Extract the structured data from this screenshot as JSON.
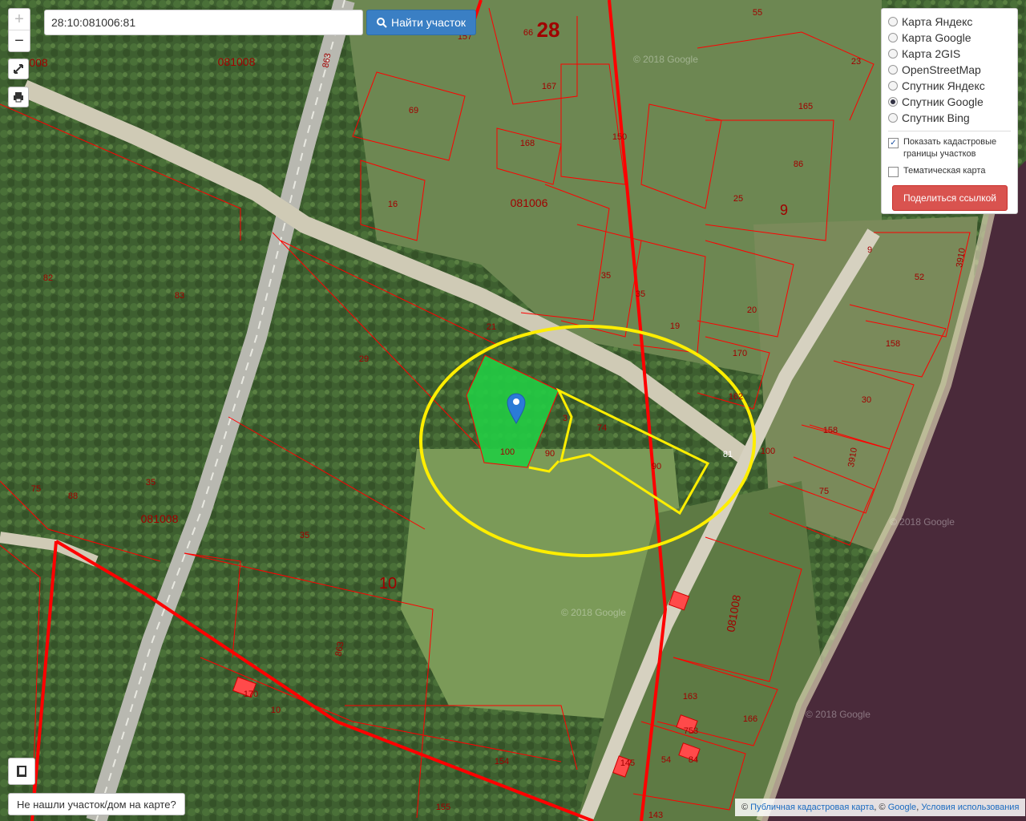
{
  "search": {
    "value": "28:10:081006:81",
    "button_label": "Найти участок"
  },
  "zoom": {
    "plus": "+",
    "minus": "−"
  },
  "layers": {
    "options": [
      "Карта Яндекс",
      "Карта Google",
      "Карта 2GIS",
      "OpenStreetMap",
      "Спутник Яндекс",
      "Спутник Google",
      "Спутник Bing"
    ],
    "selected": "Спутник Google",
    "show_borders_label": "Показать кадастровые границы участков",
    "show_borders_checked": true,
    "thematic_label": "Тематическая карта",
    "thematic_checked": false,
    "share_label": "Поделиться ссылкой"
  },
  "not_found_label": "Не нашли участок/дом на карте?",
  "attribution": {
    "copy1": "©",
    "cadastral_link": "Публичная кадастровая карта",
    "copy2": ", ©",
    "google_link": "Google",
    "sep": ",",
    "terms_link": "Условия использования"
  },
  "watermark": "© 2018 Google",
  "colors": {
    "parcel_line": "#ff0000",
    "selected_fill": "#22cc44",
    "highlight": "#ffee00",
    "water": "#4a2a3a",
    "marker": "#2b7bd6"
  },
  "parcel_labels": [
    "008",
    "081008",
    "863",
    "157",
    "66",
    "55",
    "23",
    "69",
    "167",
    "165",
    "150",
    "168",
    "86",
    "16",
    "081006",
    "25",
    "9",
    "3910",
    "52",
    "82",
    "83",
    "35",
    "35",
    "19",
    "20",
    "21",
    "29",
    "158",
    "170",
    "162",
    "30",
    "3",
    "74",
    "90",
    "100",
    "90",
    "81",
    "100",
    "158",
    "3910",
    "75",
    "75",
    "88",
    "35",
    "081008",
    "35",
    "081008",
    "863",
    "170",
    "10",
    "163",
    "166",
    "753",
    "54",
    "84",
    "154",
    "155",
    "143",
    "145",
    "33",
    "081006",
    "142",
    "62"
  ],
  "block_labels": [
    "28",
    "9",
    "10"
  ]
}
